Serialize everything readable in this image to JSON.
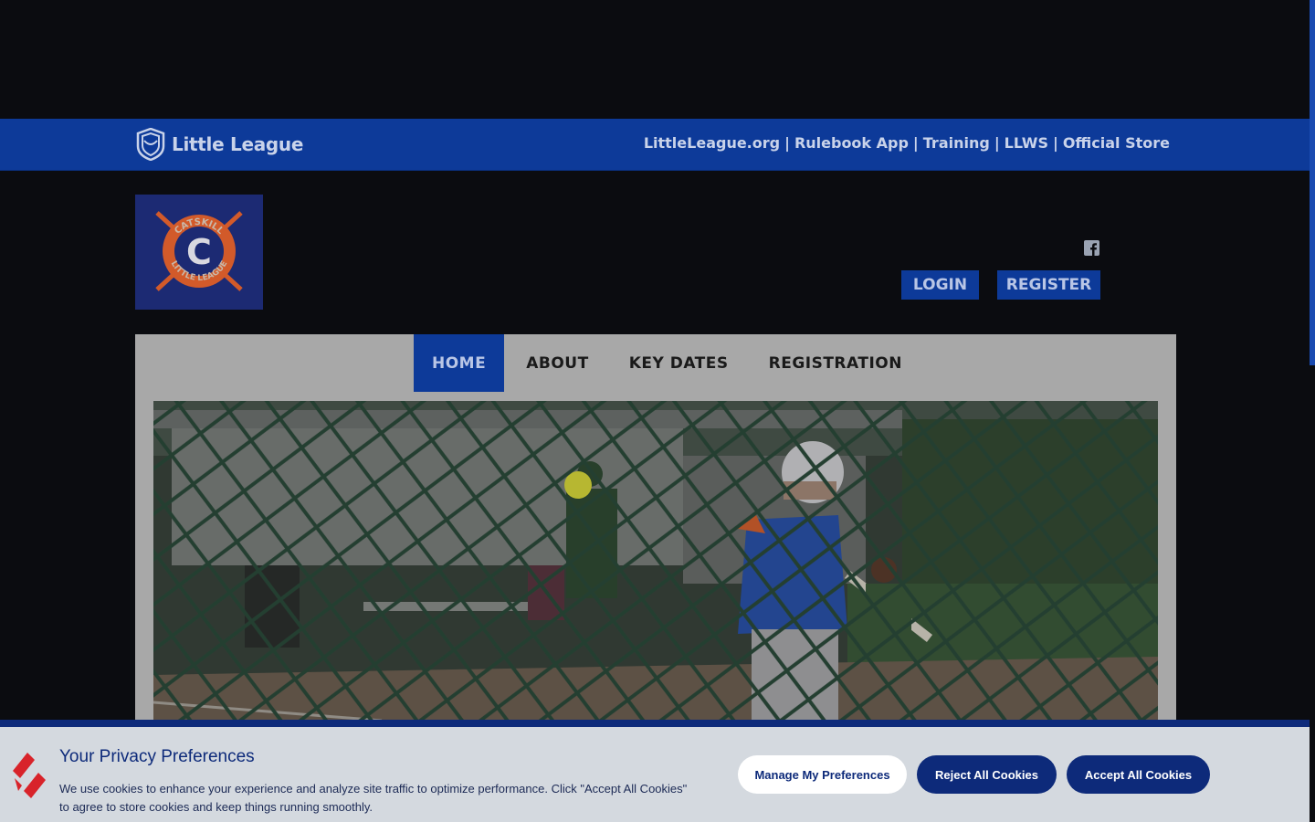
{
  "ll_bar": {
    "brand": "Little League",
    "links": [
      "LittleLeague.org",
      "Rulebook App",
      "Training",
      "LLWS",
      "Official Store"
    ],
    "separator": "|"
  },
  "league": {
    "logo_name": "Catskill Little League logo",
    "logo_top_text": "CATSKILL",
    "logo_bottom_text": "LITTLE LEAGUE",
    "logo_letter": "C"
  },
  "header": {
    "login_label": "LOGIN",
    "register_label": "REGISTER",
    "social_icon": "facebook-icon"
  },
  "nav": {
    "items": [
      "HOME",
      "ABOUT",
      "KEY DATES",
      "REGISTRATION"
    ],
    "active_index": 0
  },
  "cookie": {
    "title": "Your Privacy Preferences",
    "text": "We use cookies to enhance your experience and analyze site traffic to optimize performance. Click \"Accept All Cookies\" to agree to store cookies and keep things running smoothly.",
    "manage_label": "Manage My Preferences",
    "reject_label": "Reject All Cookies",
    "accept_label": "Accept All Cookies"
  },
  "colors": {
    "brand_blue": "#0d3a99",
    "banner_navy": "#0d2a7a",
    "page_bg": "#0b0c10",
    "cookie_red": "#d8232a"
  }
}
